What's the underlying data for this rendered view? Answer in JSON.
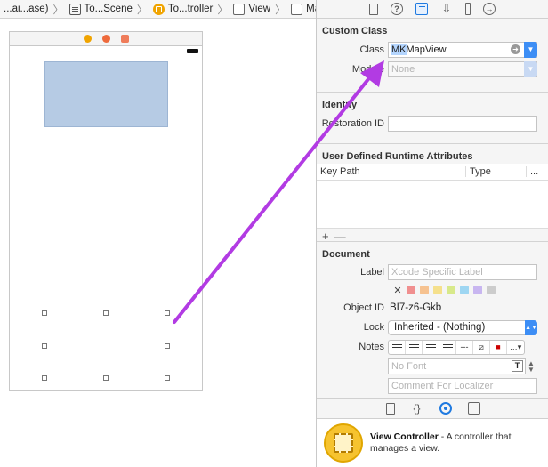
{
  "breadcrumb": [
    {
      "label": "...ai...ase)",
      "icon": "storyboard-icon"
    },
    {
      "label": "To...Scene",
      "icon": "scene-icon"
    },
    {
      "label": "To...troller",
      "icon": "view-controller-icon"
    },
    {
      "label": "View",
      "icon": "view-icon"
    },
    {
      "label": "Map View",
      "icon": "view-icon"
    }
  ],
  "inspector": {
    "custom_class": {
      "title": "Custom Class",
      "class_label": "Class",
      "class_value_selected": "MK",
      "class_value_rest": "MapView",
      "module_label": "Module",
      "module_placeholder": "None"
    },
    "identity": {
      "title": "Identity",
      "restoration_label": "Restoration ID"
    },
    "runtime_attrs": {
      "title": "User Defined Runtime Attributes",
      "col_keypath": "Key Path",
      "col_type": "Type",
      "col_more": "...",
      "add": "+",
      "remove": "—"
    },
    "document": {
      "title": "Document",
      "label_label": "Label",
      "label_placeholder": "Xcode Specific Label",
      "clear": "✕",
      "object_id_label": "Object ID",
      "object_id_value": "BI7-z6-Gkb",
      "lock_label": "Lock",
      "lock_value": "Inherited - (Nothing)",
      "notes_label": "Notes",
      "font_placeholder": "No Font",
      "comment_placeholder": "Comment For Localizer",
      "swatch_colors": [
        "#f08f8f",
        "#f6c290",
        "#f5e08c",
        "#d8e98a",
        "#9ed6f2",
        "#c8b6f0",
        "#cccccc"
      ]
    }
  },
  "library": {
    "item_title": "View Controller",
    "item_desc": " - A controller that manages a view."
  },
  "annotation": {
    "arrow_color": "#b23be3"
  }
}
